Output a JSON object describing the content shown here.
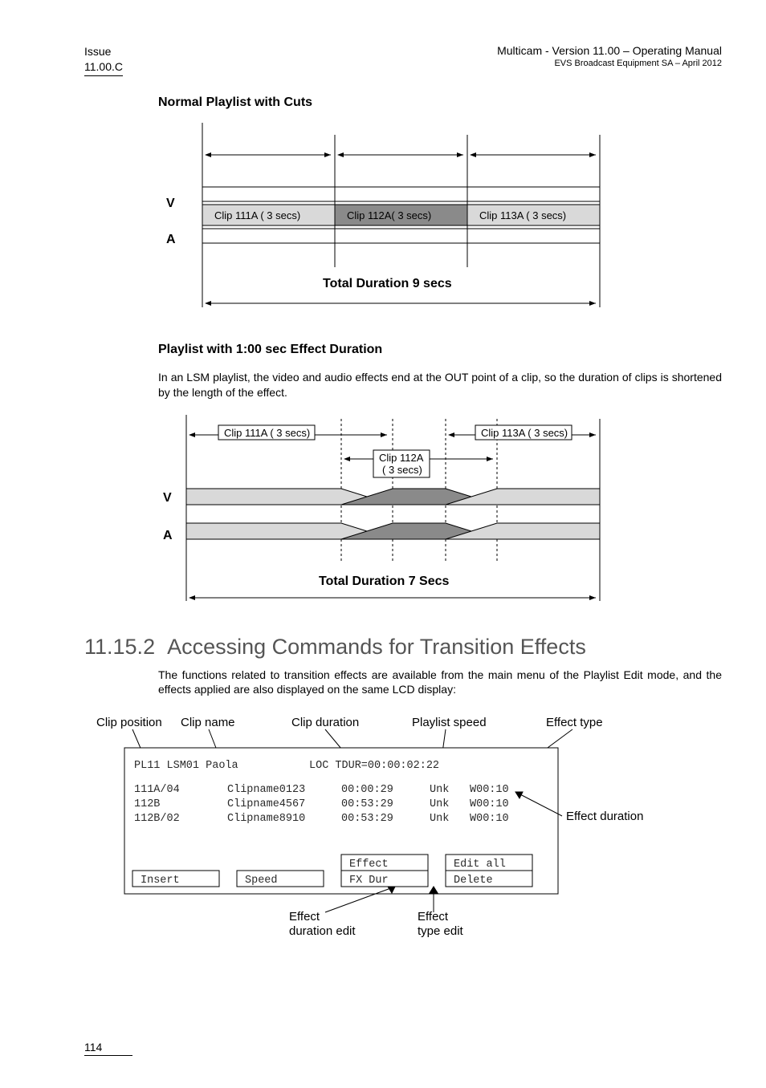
{
  "header": {
    "issue_label": "Issue",
    "issue_value": "11.00.C",
    "title": "Multicam - Version 11.00 – Operating Manual",
    "subtitle": "EVS Broadcast Equipment SA – April 2012"
  },
  "section1": {
    "heading": "Normal Playlist with Cuts",
    "v_label": "V",
    "a_label": "A",
    "clip1": "Clip 111A ( 3 secs)",
    "clip2": "Clip 112A( 3 secs)",
    "clip3": "Clip 113A ( 3 secs)",
    "total": "Total Duration 9 secs"
  },
  "section2": {
    "heading": "Playlist with 1:00 sec Effect Duration",
    "paragraph": "In an LSM playlist, the video and audio effects end at the OUT point of a clip, so the duration of clips is shortened by the length of the effect.",
    "v_label": "V",
    "a_label": "A",
    "clip1": "Clip 111A ( 3 secs)",
    "clip2a": "Clip 112A",
    "clip2b": "( 3 secs)",
    "clip3": "Clip 113A ( 3 secs)",
    "total": "Total Duration 7 Secs"
  },
  "section3": {
    "number": "11.15.2",
    "title": "Accessing Commands for Transition Effects",
    "paragraph": "The functions related to transition effects are available from the main menu of the Playlist Edit mode, and the effects applied are also displayed on the same LCD display:"
  },
  "lcd": {
    "annot_clip_position": "Clip position",
    "annot_clip_name": "Clip name",
    "annot_clip_duration": "Clip duration",
    "annot_playlist_speed": "Playlist speed",
    "annot_effect_type": "Effect type",
    "annot_effect_duration": "Effect duration",
    "annot_effect_dur_edit1": "Effect",
    "annot_effect_dur_edit2": "duration edit",
    "annot_effect_type_edit1": "Effect",
    "annot_effect_type_edit2": "type edit",
    "title_line": "PL11 LSM01 Paola",
    "loc_label": "LOC TDUR=00:00:02:22",
    "row1": {
      "pos": "111A/04",
      "name": "Clipname0123",
      "dur": "00:00:29",
      "spd": "Unk",
      "fx": "W00:10"
    },
    "row2": {
      "pos": "112B",
      "name": "Clipname4567",
      "dur": "00:53:29",
      "spd": "Unk",
      "fx": "W00:10"
    },
    "row3": {
      "pos": "112B/02",
      "name": "Clipname8910",
      "dur": "00:53:29",
      "spd": "Unk",
      "fx": "W00:10"
    },
    "btn_insert": "Insert",
    "btn_speed": "Speed",
    "btn_effect": "Effect",
    "btn_fxdur": "FX Dur",
    "btn_editall": "Edit all",
    "btn_delete": "Delete"
  },
  "footer": {
    "page": "114"
  }
}
